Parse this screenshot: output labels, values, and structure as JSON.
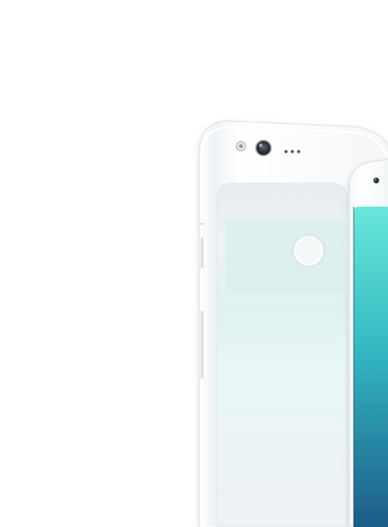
{
  "image": {
    "subject": "phone-product-photo",
    "colors": {
      "background": "#ffffff",
      "phone_body": "#f5f6f8",
      "glass_window": "#e9eef2",
      "glass_tint": "#dff1ef",
      "screen_top": "#69e7da",
      "screen_bottom": "#1d5b86",
      "fingerprint_ring": "#dfe7ea",
      "camera_dark": "#2d3339"
    },
    "icons": {
      "fingerprint": "fingerprint-sensor-icon",
      "camera": "camera-lens-icon",
      "front_camera": "front-camera-icon"
    }
  }
}
